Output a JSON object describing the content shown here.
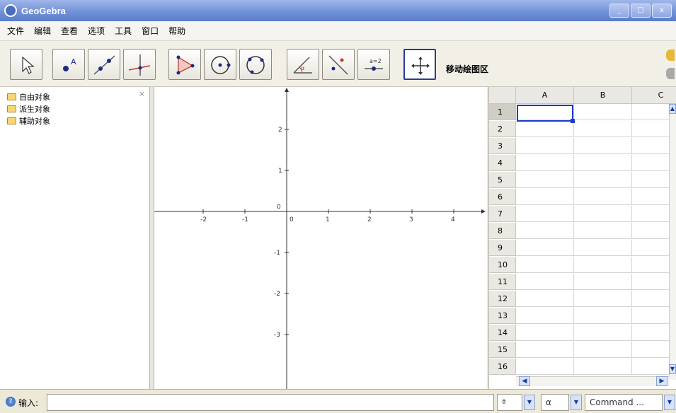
{
  "window": {
    "title": "GeoGebra"
  },
  "menu": [
    "文件",
    "编辑",
    "查看",
    "选项",
    "工具",
    "窗口",
    "帮助"
  ],
  "toolbar": {
    "active_tool_caption": "移动绘图区",
    "tools": [
      "move-tool",
      "point-tool",
      "line-tool",
      "perpendicular-tool",
      "polygon-tool",
      "circle-tool",
      "conic-tool",
      "angle-tool",
      "reflect-tool",
      "slider-tool",
      "move-graphics-tool"
    ]
  },
  "algebra": {
    "folders": [
      "自由对象",
      "派生对象",
      "辅助对象"
    ]
  },
  "graphics": {
    "x_ticks": [
      "-2",
      "-1",
      "0",
      "1",
      "2",
      "3",
      "4"
    ],
    "y_ticks": [
      "2",
      "1",
      "0",
      "-1",
      "-2",
      "-3"
    ]
  },
  "spreadsheet": {
    "columns": [
      "A",
      "B",
      "C"
    ],
    "rows": [
      "1",
      "2",
      "3",
      "4",
      "5",
      "6",
      "7",
      "8",
      "9",
      "10",
      "11",
      "12",
      "13",
      "14",
      "15",
      "16"
    ],
    "selected_cell": "A1"
  },
  "input_bar": {
    "label": "输入:",
    "value": "",
    "symbol_combo": "ª",
    "greek_combo": "α",
    "command_combo": "Command ..."
  },
  "colors": {
    "titlebar": "#6f8fd6",
    "selection": "#1a3cc9",
    "axes": "#333333"
  }
}
